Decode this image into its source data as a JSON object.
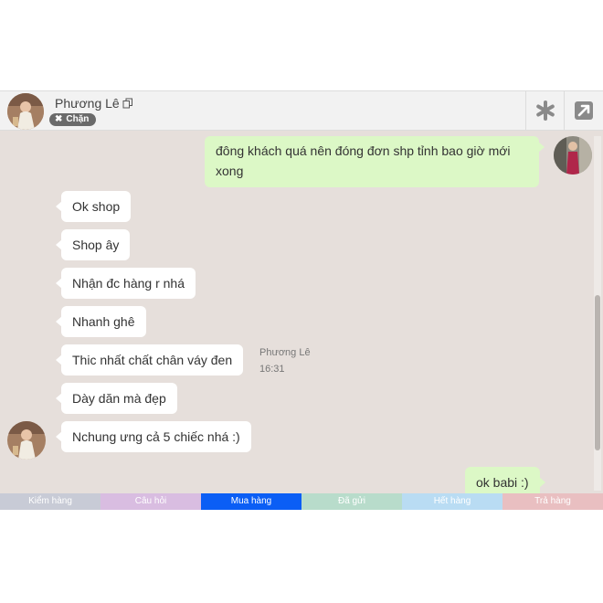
{
  "header": {
    "contact_name": "Phương Lê",
    "block_label": "Chặn"
  },
  "messages": [
    {
      "direction": "outgoing",
      "text": "đông khách quá nên đóng đơn shp tỉnh bao giờ mới xong"
    },
    {
      "direction": "incoming",
      "text": "Ok shop"
    },
    {
      "direction": "incoming",
      "text": "Shop ây"
    },
    {
      "direction": "incoming",
      "text": "Nhận đc hàng r nhá"
    },
    {
      "direction": "incoming",
      "text": "Nhanh ghê"
    },
    {
      "direction": "incoming",
      "text": "Thic nhất chất chân váy đen"
    },
    {
      "direction": "incoming",
      "text": "Dày dăn mà đẹp"
    },
    {
      "direction": "incoming",
      "text": "Nchung ưng cả 5 chiếc nhá :)"
    },
    {
      "direction": "outgoing",
      "text": "ok babi :)"
    }
  ],
  "message_meta": {
    "sender": "Phương Lê",
    "time": "16:31"
  },
  "tabs": [
    {
      "label": "Kiểm hàng",
      "color": "#c8cbd6"
    },
    {
      "label": "Câu hỏi",
      "color": "#d9bde1"
    },
    {
      "label": "Mua hàng",
      "color": "#0b5ef5"
    },
    {
      "label": "Đã gửi",
      "color": "#b8dccb"
    },
    {
      "label": "Hết hàng",
      "color": "#b9dcf3"
    },
    {
      "label": "Trả hàng",
      "color": "#e9bfc1"
    }
  ],
  "colors": {
    "chat_background": "#e6dfdb",
    "incoming_bubble": "#ffffff",
    "outgoing_bubble": "#dcf8c6",
    "header_background": "#f2f2f2"
  },
  "icons": {
    "star": "asterisk-icon",
    "popout": "external-link-icon",
    "copy": "copy-icon",
    "block": "x-icon"
  }
}
